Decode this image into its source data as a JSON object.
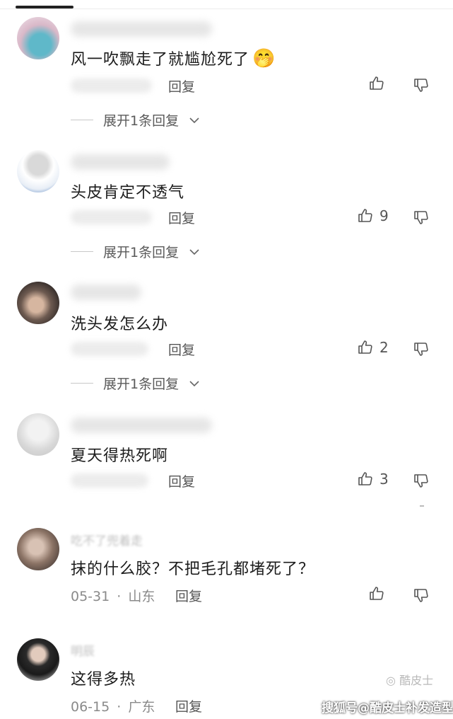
{
  "comments": [
    {
      "content": "风一吹飘走了就尴尬死了",
      "emoji": "🤭",
      "reply_label": "回复",
      "like_count": "",
      "expand_label": "展开1条回复"
    },
    {
      "content": "头皮肯定不透气",
      "reply_label": "回复",
      "like_count": "9",
      "expand_label": "展开1条回复"
    },
    {
      "content": "洗头发怎么办",
      "reply_label": "回复",
      "like_count": "2",
      "expand_label": "展开1条回复"
    },
    {
      "content": "夏天得热死啊",
      "reply_label": "回复",
      "like_count": "3"
    },
    {
      "username": "吃不了兜着走",
      "content": "抹的什么胶？不把毛孔都堵死了？",
      "date": "05-31",
      "location": "山东",
      "reply_label": "回复",
      "like_count": ""
    },
    {
      "username": "明辰",
      "content": "这得多热",
      "date": "06-15",
      "location": "广东",
      "reply_label": "回复"
    }
  ],
  "meta_separator": "·",
  "watermark": {
    "text": "搜狐号@酷皮士补发造型",
    "logo_text": "酷皮士"
  },
  "colors": {
    "text": "#1c1c1c",
    "meta": "#8a8a8a",
    "icon": "#555555"
  }
}
